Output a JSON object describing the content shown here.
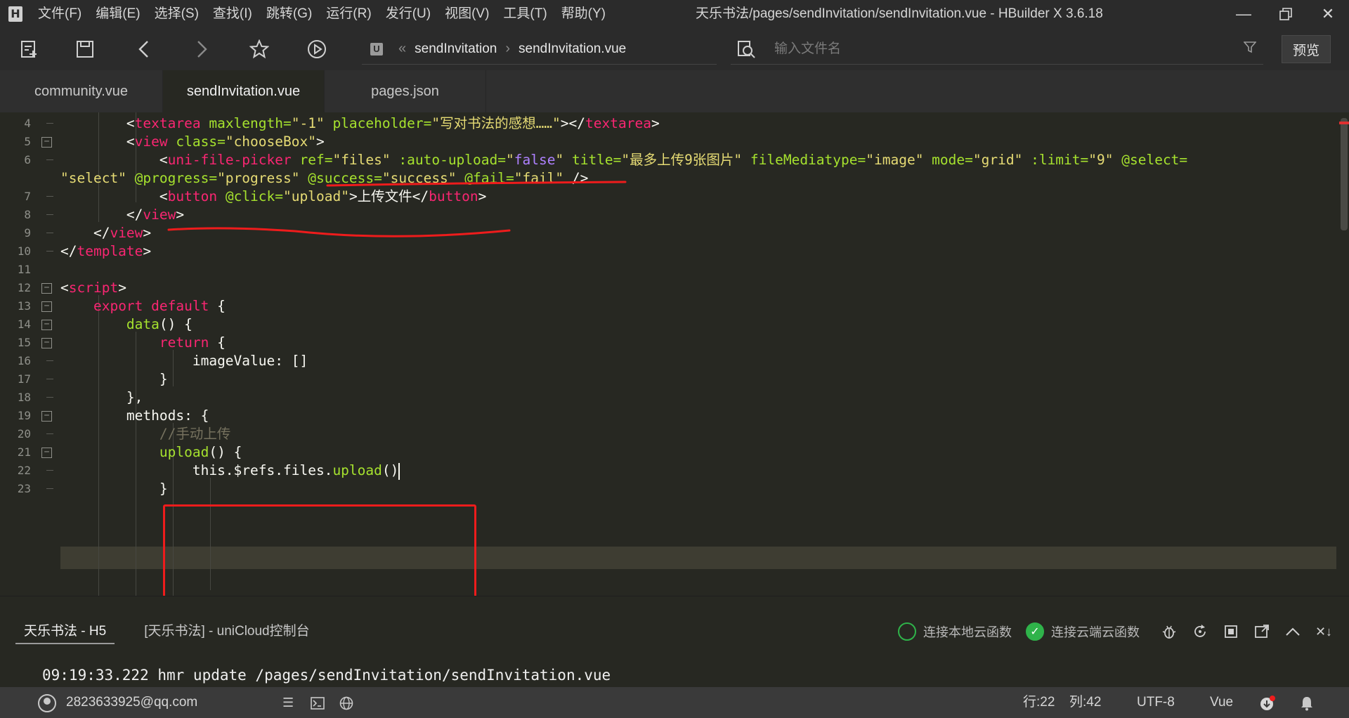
{
  "app": {
    "logo": "H",
    "window_title": "天乐书法/pages/sendInvitation/sendInvitation.vue - HBuilder X 3.6.18",
    "menu": [
      "文件(F)",
      "编辑(E)",
      "选择(S)",
      "查找(I)",
      "跳转(G)",
      "运行(R)",
      "发行(U)",
      "视图(V)",
      "工具(T)",
      "帮助(Y)"
    ]
  },
  "toolbar": {
    "breadcrumb": {
      "badge": "U",
      "folder": "sendInvitation",
      "file": "sendInvitation.vue"
    },
    "search_placeholder": "输入文件名",
    "preview_label": "预览"
  },
  "tabs": [
    {
      "label": "community.vue",
      "active": false
    },
    {
      "label": "sendInvitation.vue",
      "active": true
    },
    {
      "label": "pages.json",
      "active": false
    }
  ],
  "editor": {
    "line_numbers": [
      "4",
      "5",
      "6",
      "",
      "7",
      "8",
      "9",
      "10",
      "11",
      "12",
      "13",
      "14",
      "15",
      "16",
      "17",
      "18",
      "19",
      "20",
      "21",
      "22",
      "23"
    ],
    "code": {
      "l4": {
        "indent": "        ",
        "open": "<",
        "tag": "textarea",
        "a1": " maxlength=",
        "v1": "\"-1\"",
        "a2": " placeholder=",
        "v2": "\"写对书法的感想……\"",
        "close": "></",
        "tag2": "textarea",
        "end": ">"
      },
      "l5": {
        "indent": "        ",
        "open": "<",
        "tag": "view",
        "a1": " class=",
        "v1": "\"chooseBox\"",
        "end": ">"
      },
      "l6a": {
        "indent": "            ",
        "open": "<",
        "tag": "uni-file-picker",
        "a1": " ref=",
        "v1": "\"files\"",
        "a2": " :auto-upload=",
        "v2q1": "\"",
        "v2": "false",
        "v2q2": "\"",
        "a3": " title=",
        "v3": "\"最多上传9张图片\"",
        "a4": " fileMediatype=",
        "v4": "\"image\"",
        "a5": " mode=",
        "v5": "\"grid\"",
        "a6": " :limit=",
        "v6": "\"9\"",
        "a7": " @select="
      },
      "l6b": {
        "v7": "\"select\"",
        "a8": " @progress=",
        "v8": "\"progress\"",
        "a9": " @success=",
        "v9": "\"success\"",
        "a10": " @fail=",
        "v10": "\"fail\"",
        "end": " />"
      },
      "l7": {
        "indent": "            ",
        "open": "<",
        "tag": "button",
        "a1": " @click=",
        "v1": "\"upload\"",
        "text": ">上传文件</",
        "tag2": "button",
        "end": ">"
      },
      "l8": {
        "indent": "        ",
        "open": "</",
        "tag": "view",
        "end": ">"
      },
      "l9": {
        "indent": "    ",
        "open": "</",
        "tag": "view",
        "end": ">"
      },
      "l10": {
        "open": "</",
        "tag": "template",
        "end": ">"
      },
      "l12": {
        "open": "<",
        "tag": "script",
        "end": ">"
      },
      "l13": {
        "indent": "    ",
        "kw1": "export",
        "sp": " ",
        "kw2": "default",
        "end": " {"
      },
      "l14": {
        "indent": "        ",
        "fn": "data",
        "end": "() {"
      },
      "l15": {
        "indent": "            ",
        "kw": "return",
        "end": " {"
      },
      "l16": {
        "indent": "                ",
        "text": "imageValue: []"
      },
      "l17": {
        "indent": "            ",
        "text": "}"
      },
      "l18": {
        "indent": "        ",
        "text": "},"
      },
      "l19": {
        "indent": "        ",
        "text": "methods: {"
      },
      "l20": {
        "indent": "            ",
        "comment": "//手动上传"
      },
      "l21": {
        "indent": "            ",
        "fn": "upload",
        "end": "() {"
      },
      "l22": {
        "indent": "                ",
        "pre": "this.$refs.files.",
        "fn": "upload",
        "end": "()"
      },
      "l23": {
        "indent": "            ",
        "text": "}"
      }
    }
  },
  "console": {
    "tabs": [
      "天乐书法 - H5",
      "[天乐书法] - uniCloud控制台"
    ],
    "local_cloud_label": "连接本地云函数",
    "remote_cloud_label": "连接云端云函数",
    "output": "09:19:33.222 hmr update /pages/sendInvitation/sendInvitation.vue"
  },
  "status": {
    "user": "2823633925@qq.com",
    "line": "行:22",
    "col": "列:42",
    "encoding": "UTF-8",
    "language": "Vue"
  },
  "colors": {
    "annotation": "#ee1c1c",
    "accent_green": "#2fb34a"
  }
}
